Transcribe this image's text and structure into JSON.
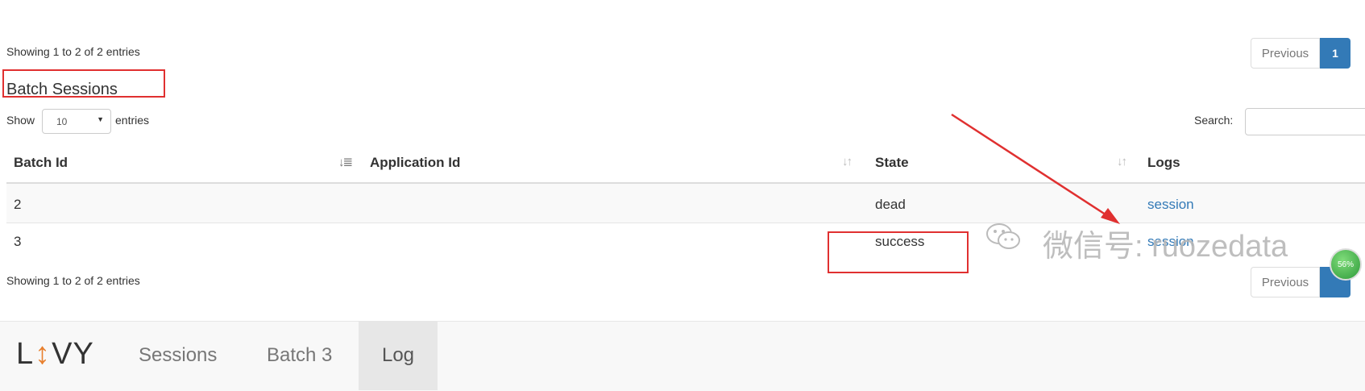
{
  "top": {
    "showing": "Showing 1 to 2 of 2 entries",
    "previous": "Previous",
    "page": "1"
  },
  "section": {
    "title": "Batch Sessions"
  },
  "controls": {
    "show_label": "Show",
    "length_value": "10",
    "entries_label": "entries",
    "search_label": "Search:",
    "search_value": ""
  },
  "table": {
    "headers": [
      "Batch Id",
      "Application Id",
      "State",
      "Logs"
    ],
    "rows": [
      {
        "batch_id": "2",
        "application_id": "",
        "state": "dead",
        "logs": "session"
      },
      {
        "batch_id": "3",
        "application_id": "",
        "state": "success",
        "logs": "session"
      }
    ]
  },
  "bottom": {
    "showing": "Showing 1 to 2 of 2 entries",
    "previous": "Previous"
  },
  "badge": {
    "percent": "56%"
  },
  "watermark": {
    "text": "微信号: ruozedata"
  },
  "navbar": {
    "brand": "LIVY",
    "items": [
      "Sessions",
      "Batch 3",
      "Log"
    ],
    "active_index": 2
  },
  "colors": {
    "link": "#337ab7",
    "annotation": "#e03030",
    "badge": "#3aa84a",
    "navbar_bg": "#f8f8f8",
    "nav_active_bg": "#e7e7e7"
  }
}
